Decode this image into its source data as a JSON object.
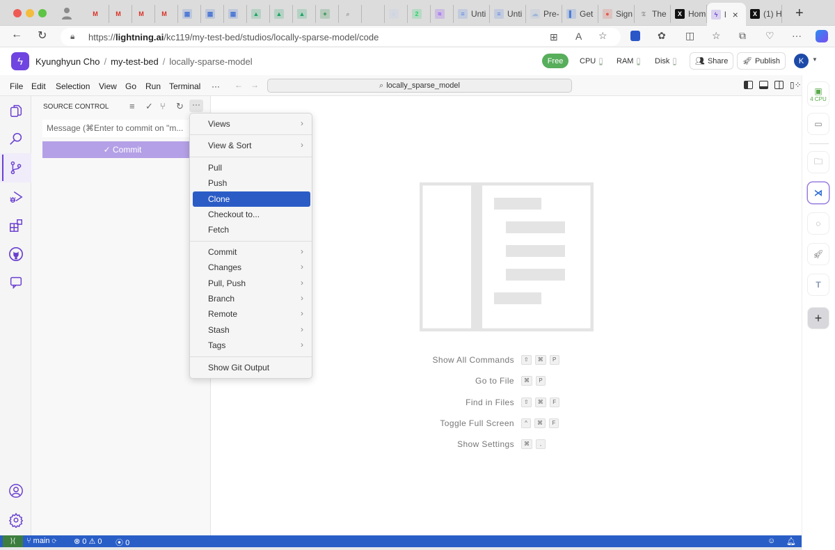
{
  "browser": {
    "tabs": [
      {
        "icon": "account-icon",
        "label": ""
      },
      {
        "icon": "gmail-icon",
        "label": ""
      },
      {
        "icon": "gmail-icon",
        "label": ""
      },
      {
        "icon": "gmail-icon",
        "label": ""
      },
      {
        "icon": "gmail-icon",
        "label": ""
      },
      {
        "icon": "calendar-icon",
        "label": ""
      },
      {
        "icon": "calendar-icon",
        "label": ""
      },
      {
        "icon": "calendar-icon",
        "label": ""
      },
      {
        "icon": "google-drive-icon",
        "label": ""
      },
      {
        "icon": "google-drive-icon",
        "label": ""
      },
      {
        "icon": "google-drive-icon",
        "label": ""
      },
      {
        "icon": "google-sheets-icon",
        "label": ""
      },
      {
        "icon": "search-icon",
        "label": ""
      },
      {
        "icon": "blank-page-icon",
        "label": ""
      },
      {
        "icon": "circle-icon",
        "label": ""
      },
      {
        "icon": "whatsapp-icon",
        "label": ""
      },
      {
        "icon": "messenger-icon",
        "label": ""
      },
      {
        "icon": "docs-icon",
        "label": "Unti"
      },
      {
        "icon": "docs-icon",
        "label": "Unti"
      },
      {
        "icon": "cloud-icon",
        "label": "Pre-"
      },
      {
        "icon": "panel-icon",
        "label": "Get"
      },
      {
        "icon": "apple-icon",
        "label": "Sign"
      },
      {
        "icon": "nyt-icon",
        "label": "The"
      },
      {
        "icon": "x-icon",
        "label": "Hom"
      },
      {
        "icon": "lightning-icon",
        "label": "l",
        "active": true
      },
      {
        "icon": "x-icon",
        "label": "(1) H"
      }
    ],
    "new_tab": "+",
    "url_prefix": "https://",
    "url_domain": "lightning.ai",
    "url_path": "/kc119/my-test-bed/studios/locally-sparse-model/code"
  },
  "header": {
    "breadcrumbs": [
      "Kyunghyun Cho",
      "my-test-bed",
      "locally-sparse-model"
    ],
    "separator": "/",
    "plan_badge": "Free",
    "meters": [
      {
        "label": "CPU",
        "level": 0.15
      },
      {
        "label": "RAM",
        "level": 0.15
      },
      {
        "label": "Disk",
        "level": 0.1
      }
    ],
    "share_label": "Share",
    "publish_label": "Publish",
    "avatar_initial": "K"
  },
  "menubar": {
    "items": [
      "File",
      "Edit",
      "Selection",
      "View",
      "Go",
      "Run",
      "Terminal"
    ],
    "more": "···",
    "command_center": "locally_sparse_model"
  },
  "sidebar": {
    "title": "SOURCE CONTROL",
    "message_placeholder": "Message (⌘Enter to commit on \"m...",
    "commit_label": "✓ Commit",
    "more": "···"
  },
  "context_menu": {
    "groups": [
      [
        {
          "label": "Views",
          "submenu": true
        }
      ],
      [
        {
          "label": "View & Sort",
          "submenu": true
        }
      ],
      [
        {
          "label": "Pull"
        },
        {
          "label": "Push"
        },
        {
          "label": "Clone",
          "highlighted": true
        },
        {
          "label": "Checkout to..."
        },
        {
          "label": "Fetch"
        }
      ],
      [
        {
          "label": "Commit",
          "submenu": true
        },
        {
          "label": "Changes",
          "submenu": true
        },
        {
          "label": "Pull, Push",
          "submenu": true
        },
        {
          "label": "Branch",
          "submenu": true
        },
        {
          "label": "Remote",
          "submenu": true
        },
        {
          "label": "Stash",
          "submenu": true
        },
        {
          "label": "Tags",
          "submenu": true
        }
      ],
      [
        {
          "label": "Show Git Output"
        }
      ]
    ]
  },
  "editor": {
    "hints": [
      {
        "label": "Show All Commands",
        "keys": [
          "⇧",
          "⌘",
          "P"
        ]
      },
      {
        "label": "Go to File",
        "keys": [
          "⌘",
          "P"
        ]
      },
      {
        "label": "Find in Files",
        "keys": [
          "⇧",
          "⌘",
          "F"
        ]
      },
      {
        "label": "Toggle Full Screen",
        "keys": [
          "^",
          "⌘",
          "F"
        ]
      },
      {
        "label": "Show Settings",
        "keys": [
          "⌘",
          ","
        ]
      }
    ]
  },
  "rail": {
    "cpu_label": "4 CPU"
  },
  "status": {
    "branch": "main",
    "errors": "0",
    "warnings": "0",
    "ports": "0"
  },
  "colors": {
    "accent": "#6a3fd0",
    "statusbar": "#2a5ec7",
    "menu_highlight": "#2b5cc6",
    "free_badge": "#57ae5b"
  }
}
